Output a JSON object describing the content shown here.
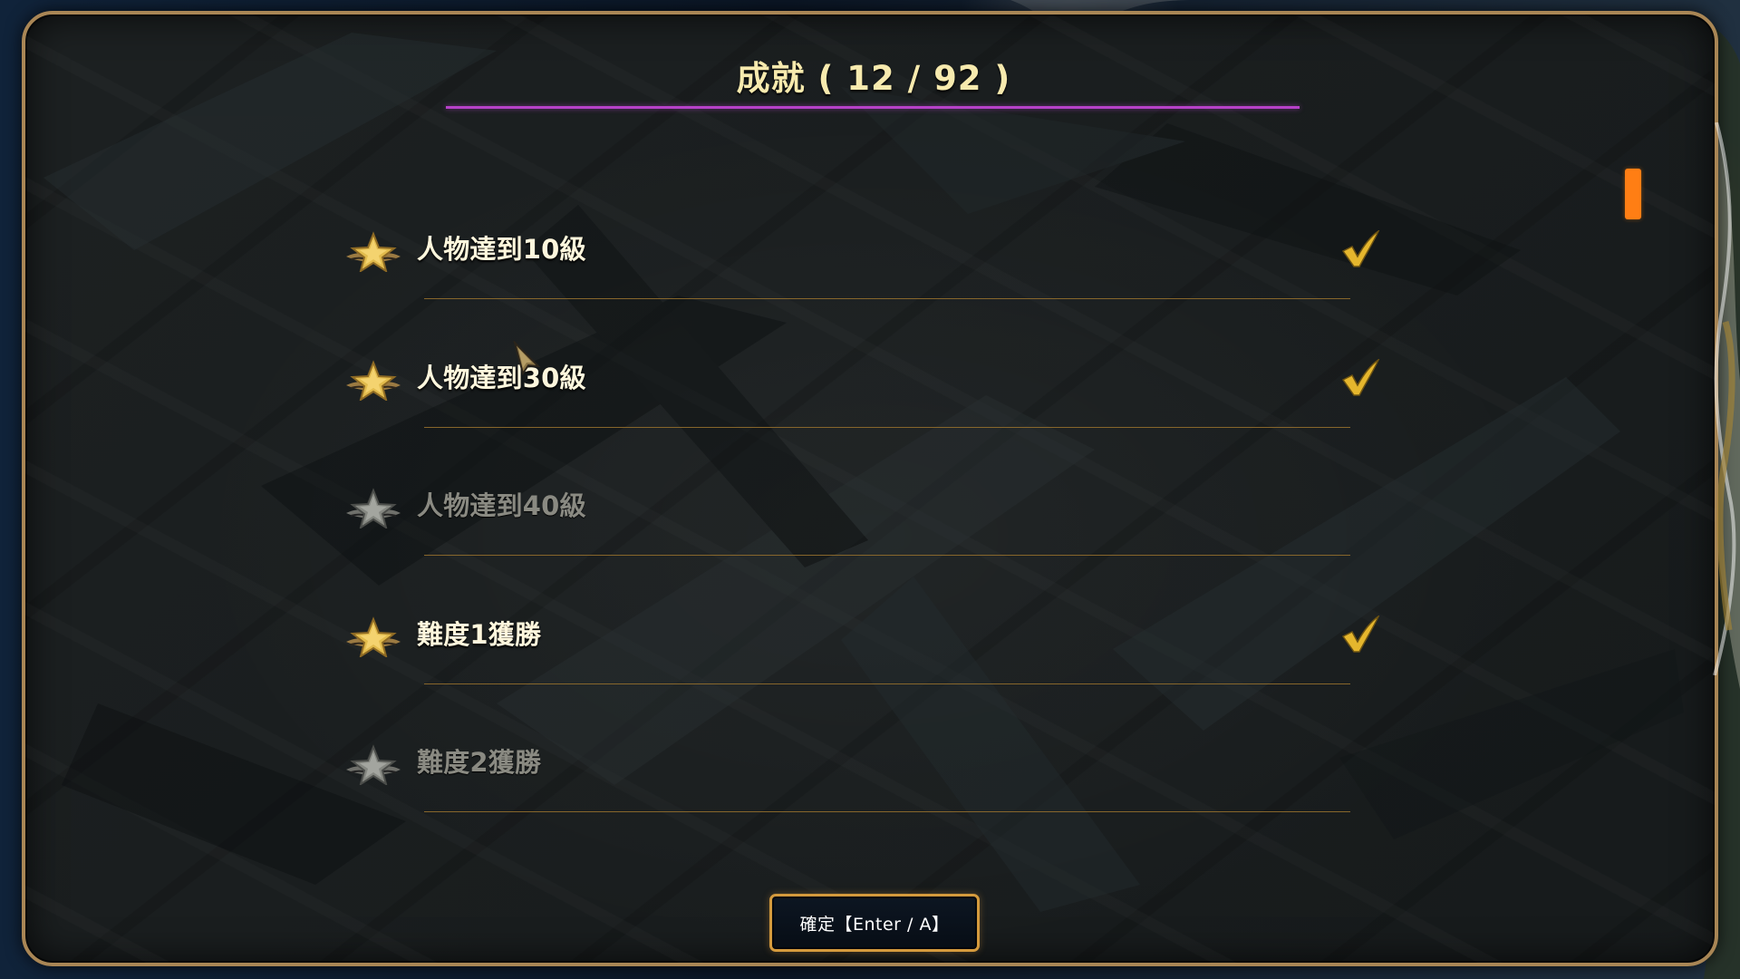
{
  "screen": {
    "title": "成就 ( 12 / 92 )"
  },
  "achievements": [
    {
      "label": "人物達到10級",
      "medal_icon": "gold-medal-icon",
      "completed": true,
      "check_icon": "check-icon"
    },
    {
      "label": "人物達到30級",
      "medal_icon": "gold-medal-icon",
      "completed": true,
      "check_icon": "check-icon"
    },
    {
      "label": "人物達到40級",
      "medal_icon": "silver-medal-icon",
      "completed": false
    },
    {
      "label": "難度1獲勝",
      "medal_icon": "gold-medal-icon",
      "completed": true,
      "check_icon": "check-icon"
    },
    {
      "label": "難度2獲勝",
      "medal_icon": "silver-medal-icon",
      "completed": false
    }
  ],
  "controls": {
    "confirm_label": "確定【Enter / A】"
  },
  "colors": {
    "panel_border": "#a98655",
    "title_text": "#f7eaae",
    "title_underline": "#b641c8",
    "divider": "#8d6a2c",
    "check": "#e5b62d",
    "scroll_thumb": "#ff7e14",
    "locked_text": "#8a8a82"
  },
  "icons": {
    "cursor": "cursor-arrow-icon"
  }
}
